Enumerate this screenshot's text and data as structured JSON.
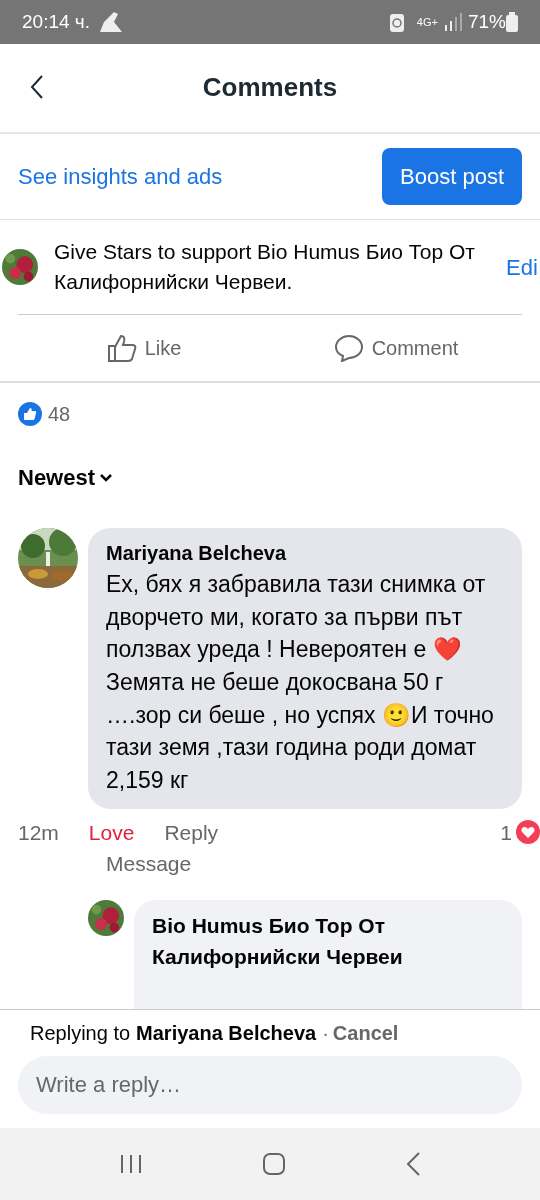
{
  "status_bar": {
    "time": "20:14 ч.",
    "network": "4G+",
    "battery": "71%"
  },
  "header": {
    "title": "Comments"
  },
  "insights": {
    "link": "See insights and ads",
    "button": "Boost post"
  },
  "stars_prompt": {
    "text": "Give Stars to support Bio Humus Био Тор От Калифорнийски Червеи.",
    "action": "Edi"
  },
  "actions": [
    {
      "kind": "like",
      "label": "Like"
    },
    {
      "kind": "comment",
      "label": "Comment"
    }
  ],
  "reactions": {
    "count": "48"
  },
  "sort": {
    "label": "Newest"
  },
  "comments": [
    {
      "author": "Mariyana Belcheva",
      "text": "Ех, бях я забравила тази снимка от дворчето ми, когато за първи път ползвах уреда ! Невероятен е ❤️ Земята не беше докосвана 50 г ….зор си беше , но успях 🙂И точно тази земя ,тази година роди домат 2,159 кг",
      "time": "12m",
      "reaction": "Love",
      "reacted": true,
      "reply": "Reply",
      "message": "Message",
      "reaction_count": "1",
      "replies": [
        {
          "author": "Bio Humus Био Тор От Калифорнийски Червеи"
        }
      ]
    }
  ],
  "reply_bar": {
    "prefix": "Replying to",
    "name": "Mariyana Belcheva",
    "separator": "·",
    "cancel": "Cancel",
    "placeholder": "Write a reply…"
  }
}
